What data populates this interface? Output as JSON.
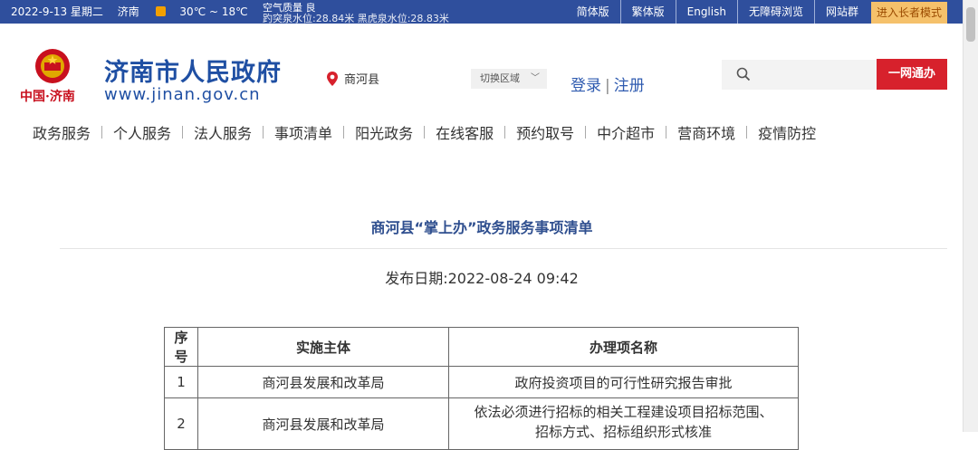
{
  "topbar": {
    "date": "2022-9-13 星期二",
    "city": "济南",
    "temperature": "30℃ ~ 18℃",
    "air_quality": "空气质量 良",
    "water_level": "趵突泉水位:28.84米 黑虎泉水位:28.83米",
    "links": [
      "简体版",
      "繁体版",
      "English",
      "无障碍浏览",
      "网站群"
    ],
    "elder_mode": "进入长者模式"
  },
  "header": {
    "logo_text": "中国·济南",
    "title": "济南市人民政府",
    "url": "www.jinan.gov.cn",
    "location": "商河县",
    "region_switch": "切换区域",
    "login": "登录",
    "register": "注册",
    "search_placeholder": "",
    "search_button": "一网通办"
  },
  "nav": {
    "items": [
      "政务服务",
      "个人服务",
      "法人服务",
      "事项清单",
      "阳光政务",
      "在线客服",
      "预约取号",
      "中介超市",
      "营商环境",
      "疫情防控"
    ]
  },
  "article": {
    "title": "商河县“掌上办”政务服务事项清单",
    "publish_date": "发布日期:2022-08-24 09:42"
  },
  "table": {
    "headers": [
      "序号",
      "实施主体",
      "办理项名称"
    ],
    "rows": [
      {
        "no": "1",
        "dept": "商河县发展和改革局",
        "item": "政府投资项目的可行性研究报告审批"
      },
      {
        "no": "2",
        "dept": "商河县发展和改革局",
        "item_line1": "依法必须进行招标的相关工程建设项目招标范围、",
        "item_line2": "招标方式、招标组织形式核准"
      }
    ]
  },
  "colors": {
    "topbar": "#2f4f9d",
    "brand_blue": "#1f4fa3",
    "search_button": "#d7212c",
    "elder_button": "#f5c16b"
  }
}
